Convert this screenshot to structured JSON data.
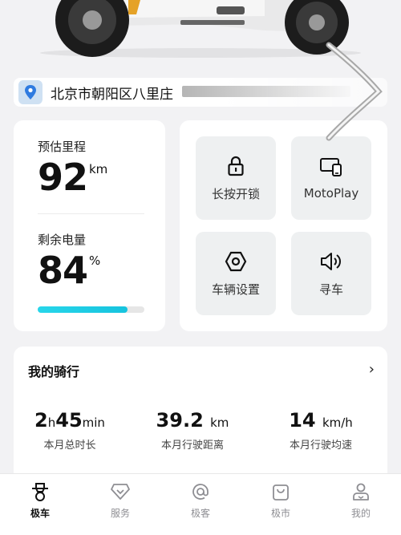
{
  "location": {
    "text": "北京市朝阳区八里庄",
    "icon": "map-pin-icon"
  },
  "stats": {
    "range_label": "预估里程",
    "range_value": "92",
    "range_unit": "km",
    "battery_label": "剩余电量",
    "battery_value": "84",
    "battery_unit": "%",
    "battery_fraction": 0.84
  },
  "controls": [
    {
      "label": "长按开锁",
      "icon": "lock-icon"
    },
    {
      "label": "MotoPlay",
      "icon": "phone-cast-icon"
    },
    {
      "label": "车辆设置",
      "icon": "hex-nut-icon"
    },
    {
      "label": "寻车",
      "icon": "speaker-icon"
    }
  ],
  "ride": {
    "title": "我的骑行",
    "chevron": "›",
    "duration": {
      "h": "2",
      "h_unit": "h",
      "m": "45",
      "m_unit": "min",
      "caption": "本月总时长"
    },
    "distance": {
      "value": "39.2",
      "unit": "km",
      "caption": "本月行驶距离"
    },
    "speed": {
      "value": "14",
      "unit": "km/h",
      "caption": "本月行驶均速"
    }
  },
  "nav": [
    {
      "label": "极车",
      "icon": "scooter-icon",
      "active": true
    },
    {
      "label": "服务",
      "icon": "diamond-icon",
      "active": false
    },
    {
      "label": "极客",
      "icon": "at-circle-icon",
      "active": false
    },
    {
      "label": "极市",
      "icon": "shopping-bag-icon",
      "active": false
    },
    {
      "label": "我的",
      "icon": "profile-icon",
      "active": false
    }
  ],
  "colors": {
    "accent": "#1ccde4",
    "card": "#ffffff",
    "background": "#f2f2f4"
  }
}
